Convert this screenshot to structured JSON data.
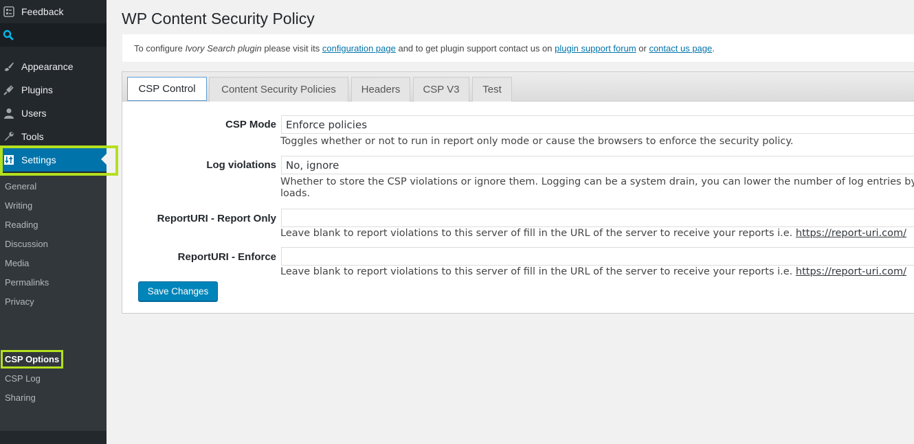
{
  "sidebar": {
    "feedback": "Feedback",
    "appearance": "Appearance",
    "plugins": "Plugins",
    "users": "Users",
    "tools": "Tools",
    "settings": "Settings",
    "submenu": [
      "General",
      "Writing",
      "Reading",
      "Discussion",
      "Media",
      "Permalinks",
      "Privacy"
    ],
    "plugin_submenu": [
      "CSP Options",
      "CSP Log",
      "Sharing"
    ]
  },
  "page": {
    "title": "WP Content Security Policy"
  },
  "notice": {
    "prefix": "To configure ",
    "plugin_name": "Ivory Search plugin",
    "middle1": " please visit its ",
    "link1": "configuration page",
    "middle2": " and to get plugin support contact us on ",
    "link2": "plugin support forum",
    "middle3": " or ",
    "link3": "contact us page",
    "suffix": "."
  },
  "tabs": [
    "CSP Control",
    "Content Security Policies",
    "Headers",
    "CSP V3",
    "Test"
  ],
  "form": {
    "csp_mode": {
      "label": "CSP Mode",
      "value": "Enforce policies",
      "desc": "Toggles whether or not to run in report only mode or cause the browsers to enforce the security policy."
    },
    "log_violations": {
      "label": "Log violations",
      "value": "No, ignore",
      "desc": "Whether to store the CSP violations or ignore them. Logging can be a system drain, you can lower the number of log entries by no",
      "desc2": "loads."
    },
    "report_only": {
      "label": "ReportURI - Report Only",
      "value": "",
      "desc": "Leave blank to report violations to this server of fill in the URL of the server to receive your reports i.e. ",
      "link": "https://report-uri.com/"
    },
    "report_enforce": {
      "label": "ReportURI - Enforce",
      "value": "",
      "desc": "Leave blank to report violations to this server of fill in the URL of the server to receive your reports i.e. ",
      "link": "https://report-uri.com/"
    },
    "save_label": "Save Changes"
  },
  "colors": {
    "sidebar_bg": "#23282d",
    "accent": "#0073aa",
    "highlight": "#b4e01e",
    "button": "#0085ba"
  }
}
